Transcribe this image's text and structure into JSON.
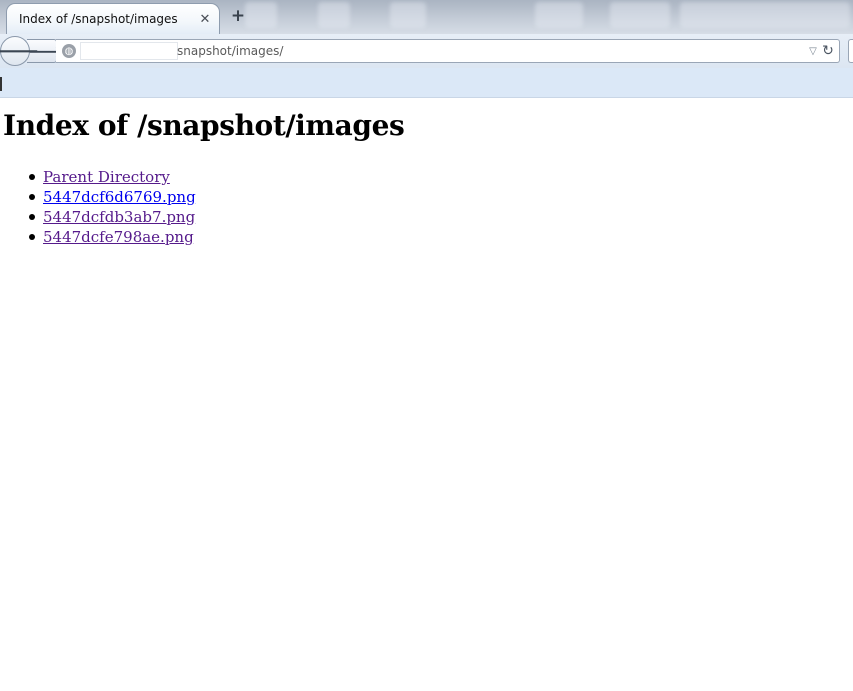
{
  "tab": {
    "title": "Index of /snapshot/images",
    "close_glyph": "✕",
    "new_tab_glyph": "+"
  },
  "toolbar": {
    "back_glyph": "🡐",
    "forward_glyph": "🡒",
    "site_icon_glyph": "◍",
    "dropdown_glyph": "▽",
    "reload_glyph": "↻"
  },
  "urlbar": {
    "url_text": "snapshot/images/"
  },
  "page": {
    "heading": "Index of /snapshot/images",
    "links": [
      {
        "label": "Parent Directory",
        "visited": true
      },
      {
        "label": "5447dcf6d6769.png",
        "visited": false
      },
      {
        "label": "5447dcfdb3ab7.png",
        "visited": true
      },
      {
        "label": "5447dcfe798ae.png",
        "visited": true
      }
    ]
  },
  "colors": {
    "link_unvisited": "#0000ee",
    "link_visited": "#551a8b",
    "bookmarks_bar": "#dbe8f7"
  }
}
